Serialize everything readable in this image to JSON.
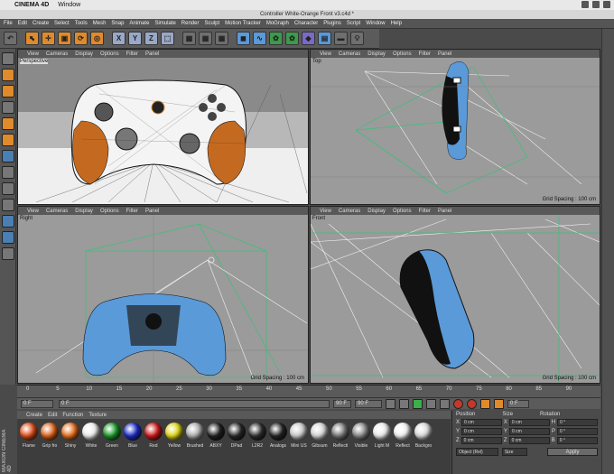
{
  "mac_menu": {
    "app": "CINEMA 4D",
    "window": "Window"
  },
  "title": "Controller White-Orange Front v3.c4d *",
  "menu": [
    "File",
    "Edit",
    "Create",
    "Select",
    "Tools",
    "Mesh",
    "Snap",
    "Animate",
    "Simulate",
    "Render",
    "Sculpt",
    "Motion Tracker",
    "MoGraph",
    "Character",
    "Plugins",
    "Script",
    "Window",
    "Help"
  ],
  "viewport_menu": [
    "View",
    "Cameras",
    "Display",
    "Options",
    "Filter",
    "Panel"
  ],
  "viewports": {
    "perspective": {
      "name": "Perspective",
      "grid": ""
    },
    "top": {
      "name": "Top",
      "grid": "Grid Spacing : 100 cm"
    },
    "right": {
      "name": "Right",
      "grid": "Grid Spacing : 100 cm"
    },
    "front": {
      "name": "Front",
      "grid": "Grid Spacing : 100 cm"
    }
  },
  "timeline": {
    "ticks": [
      "0",
      "5",
      "10",
      "15",
      "20",
      "25",
      "30",
      "35",
      "40",
      "45",
      "50",
      "55",
      "60",
      "65",
      "70",
      "75",
      "80",
      "85",
      "90"
    ]
  },
  "transport": {
    "start": "0 F",
    "current": "0 F",
    "end": "90 F",
    "end2": "90 F",
    "frame": "0 F"
  },
  "material_menu": [
    "Create",
    "Edit",
    "Function",
    "Texture"
  ],
  "materials": [
    {
      "name": "Flame",
      "color": "#e0501c"
    },
    {
      "name": "Grip fro",
      "color": "#e0641c"
    },
    {
      "name": "Shiny",
      "color": "#e8701e"
    },
    {
      "name": "White",
      "color": "#f0f0f0"
    },
    {
      "name": "Green",
      "color": "#1a9a2a"
    },
    {
      "name": "Blue",
      "color": "#1c2cc8"
    },
    {
      "name": "Red",
      "color": "#d01818"
    },
    {
      "name": "Yellow",
      "color": "#e0d818"
    },
    {
      "name": "Brushed",
      "color": "#b0b0b0"
    },
    {
      "name": "ABXY",
      "color": "#222222"
    },
    {
      "name": "DPad",
      "color": "#2a2a2a"
    },
    {
      "name": "L2R2",
      "color": "#303030"
    },
    {
      "name": "Analogs",
      "color": "#262626"
    },
    {
      "name": "Mini US",
      "color": "#cccccc"
    },
    {
      "name": "Gibsum",
      "color": "#d8d8d8"
    },
    {
      "name": "Reflecti",
      "color": "#777777"
    },
    {
      "name": "Visible",
      "color": "#888888"
    },
    {
      "name": "Light M",
      "color": "#eeeeee"
    },
    {
      "name": "Reflect",
      "color": "#f4f4f4"
    },
    {
      "name": "Backgro",
      "color": "#dddddd"
    }
  ],
  "coords": {
    "headers": [
      "Position",
      "Size",
      "Rotation"
    ],
    "rows": [
      {
        "axis": "X",
        "pos": "0 cm",
        "size": "0 cm",
        "rot_label": "H",
        "rot": "0 °"
      },
      {
        "axis": "Y",
        "pos": "0 cm",
        "size": "0 cm",
        "rot_label": "P",
        "rot": "0 °"
      },
      {
        "axis": "Z",
        "pos": "0 cm",
        "size": "0 cm",
        "rot_label": "B",
        "rot": "0 °"
      }
    ],
    "mode": "Object (Rel)",
    "size_mode": "Size",
    "apply": "Apply"
  },
  "brand": "MAXON CINEMA 4D",
  "colors": {
    "accent": "#e08a2c",
    "blue_mesh": "#5a9ad8",
    "orange_mesh": "#d07428"
  }
}
